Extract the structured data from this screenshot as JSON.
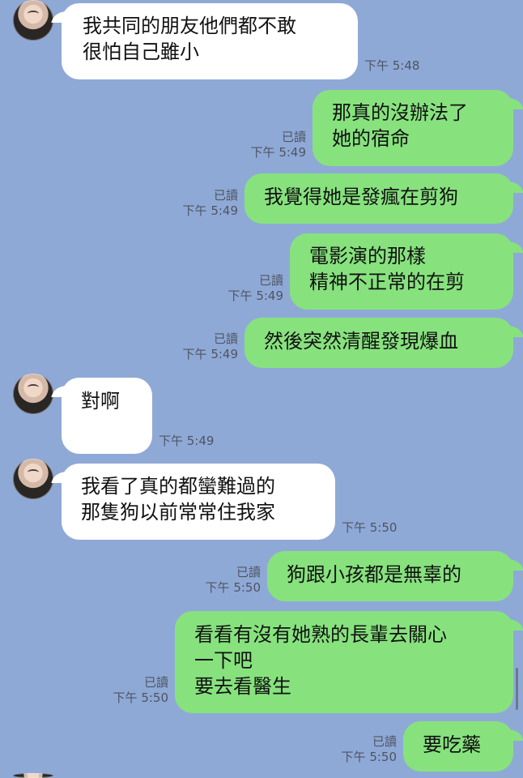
{
  "messages": [
    {
      "type": "incoming",
      "text": "我共同的朋友他們都不敢\n很怕自己雖小",
      "time": "下午 5:48"
    },
    {
      "type": "outgoing",
      "text": "那真的沒辦法了\n她的宿命",
      "read": "已讀",
      "time": "下午 5:49"
    },
    {
      "type": "outgoing",
      "text": "我覺得她是發瘋在剪狗",
      "read": "已讀",
      "time": "下午 5:49"
    },
    {
      "type": "outgoing",
      "text": "電影演的那樣\n精神不正常的在剪",
      "read": "已讀",
      "time": "下午 5:49"
    },
    {
      "type": "outgoing",
      "text": "然後突然清醒發現爆血",
      "read": "已讀",
      "time": "下午 5:49"
    },
    {
      "type": "incoming",
      "text": "對啊",
      "time": "下午 5:49"
    },
    {
      "type": "incoming",
      "text": "我看了真的都蠻難過的\n那隻狗以前常常住我家",
      "time": "下午 5:50"
    },
    {
      "type": "outgoing",
      "text": "狗跟小孩都是無辜的",
      "read": "已讀",
      "time": "下午 5:50"
    },
    {
      "type": "outgoing",
      "text": "看看有沒有她熟的長輩去關心\n一下吧\n要去看醫生",
      "read": "已讀",
      "time": "下午 5:50"
    },
    {
      "type": "outgoing",
      "text": "要吃藥",
      "read": "已讀",
      "time": "下午 5:50"
    }
  ],
  "colors": {
    "background": "#8fa9d6",
    "incoming_bubble": "#ffffff",
    "outgoing_bubble": "#87e27e",
    "meta_text": "#4e5562"
  }
}
